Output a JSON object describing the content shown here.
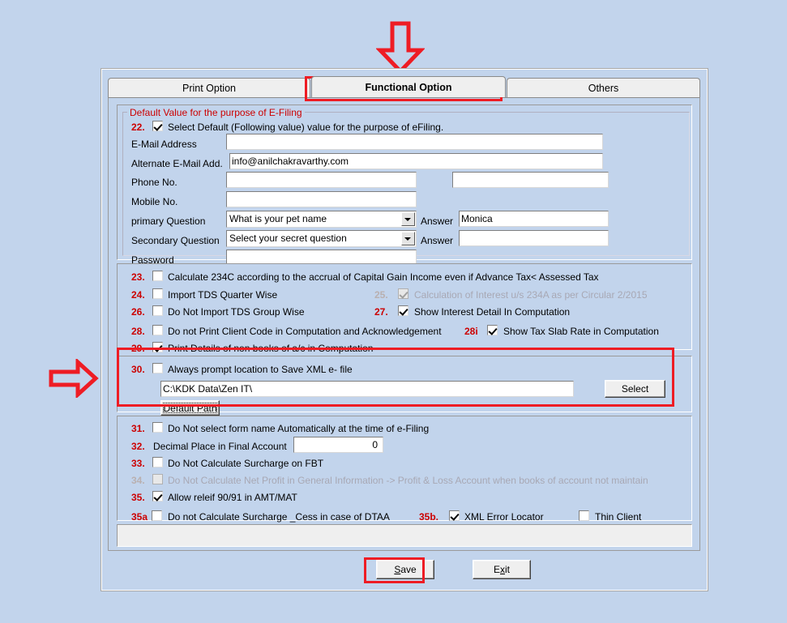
{
  "window": {
    "tabs": [
      {
        "label": "Print Option",
        "active": false
      },
      {
        "label": "Functional Option",
        "active": true
      },
      {
        "label": "Others",
        "active": false
      }
    ]
  },
  "efiling_group": {
    "title": "Default Value for the purpose of E-Filing",
    "item22": {
      "number": "22.",
      "label": "Select Default (Following value) value for the purpose of eFiling.",
      "checked": true
    },
    "fields": [
      {
        "label": "E-Mail Address",
        "value": ""
      },
      {
        "label": "Alternate E-Mail Add.",
        "value": "info@anilchakravarthy.com"
      },
      {
        "label": "Phone No.",
        "value": "",
        "value2": ""
      },
      {
        "label": "Mobile No.",
        "value": ""
      },
      {
        "label": "Password",
        "value": ""
      }
    ],
    "primary_question": {
      "label": "primary Question",
      "selected": "What is your pet name",
      "answer_label": "Answer",
      "answer_value": "Monica"
    },
    "secondary_question": {
      "label": "Secondary Question",
      "selected": "Select your secret question",
      "answer_label": "Answer",
      "answer_value": ""
    }
  },
  "options_group_a": [
    {
      "number": "23.",
      "label": "Calculate 234C according to the accrual of Capital Gain Income even if Advance Tax< Assessed Tax",
      "checked": false,
      "disabled": false
    },
    {
      "number": "24.",
      "label": "Import TDS Quarter Wise",
      "checked": false,
      "disabled": false
    },
    {
      "number": "25.",
      "label": "Calculation of Interest u/s 234A as per Circular 2/2015",
      "checked": true,
      "disabled": true
    },
    {
      "number": "26.",
      "label": "Do Not Import TDS Group Wise",
      "checked": false,
      "disabled": false
    },
    {
      "number": "27.",
      "label": "Show Interest Detail In Computation",
      "checked": true,
      "disabled": false
    },
    {
      "number": "28.",
      "label": "Do not Print Client Code in Computation and Acknowledgement",
      "checked": false,
      "disabled": false
    },
    {
      "number": "28i",
      "label": "Show Tax Slab Rate in Computation",
      "checked": true,
      "disabled": false
    },
    {
      "number": "29.",
      "label": "Print Details of non books of a/c in Computation",
      "checked": true,
      "disabled": false
    }
  ],
  "xml_group": {
    "number": "30.",
    "label": "Always prompt location to Save XML e- file",
    "checked": false,
    "path": "C:\\KDK Data\\Zen IT\\",
    "select_button": "Select",
    "default_path_button": "Default Path"
  },
  "options_group_b": [
    {
      "number": "31.",
      "label": "Do Not select form name Automatically at the time of e-Filing",
      "checked": false,
      "disabled": false
    },
    {
      "number": "32.",
      "label": "Decimal Place in Final Account",
      "value": "0",
      "type": "input"
    },
    {
      "number": "33.",
      "label": "Do Not Calculate Surcharge on FBT",
      "checked": false,
      "disabled": false
    },
    {
      "number": "34.",
      "label": "Do Not  Calculate Net Profit in General Information -> Profit & Loss Account when books of account not maintain",
      "checked": false,
      "disabled": true
    },
    {
      "number": "35.",
      "label": "Allow releif 90/91 in AMT/MAT",
      "checked": true,
      "disabled": false
    },
    {
      "number": "35a",
      "label": "Do not Calculate Surcharge _Cess in case of DTAA",
      "checked": false,
      "disabled": false
    },
    {
      "number": "35b.",
      "label": "XML Error Locator",
      "checked": true,
      "disabled": false
    },
    {
      "number": "",
      "label": "Thin Client",
      "checked": false,
      "disabled": false
    }
  ],
  "footer": {
    "save_button": {
      "prefix": "",
      "accel": "S",
      "suffix": "ave"
    },
    "exit_button": {
      "prefix": "E",
      "accel": "x",
      "suffix": "it"
    }
  },
  "colors": {
    "background": "#c2d4ec",
    "annotation_red": "#ee1c24",
    "label_red": "#cc0000",
    "panel_gray": "#efefef"
  }
}
